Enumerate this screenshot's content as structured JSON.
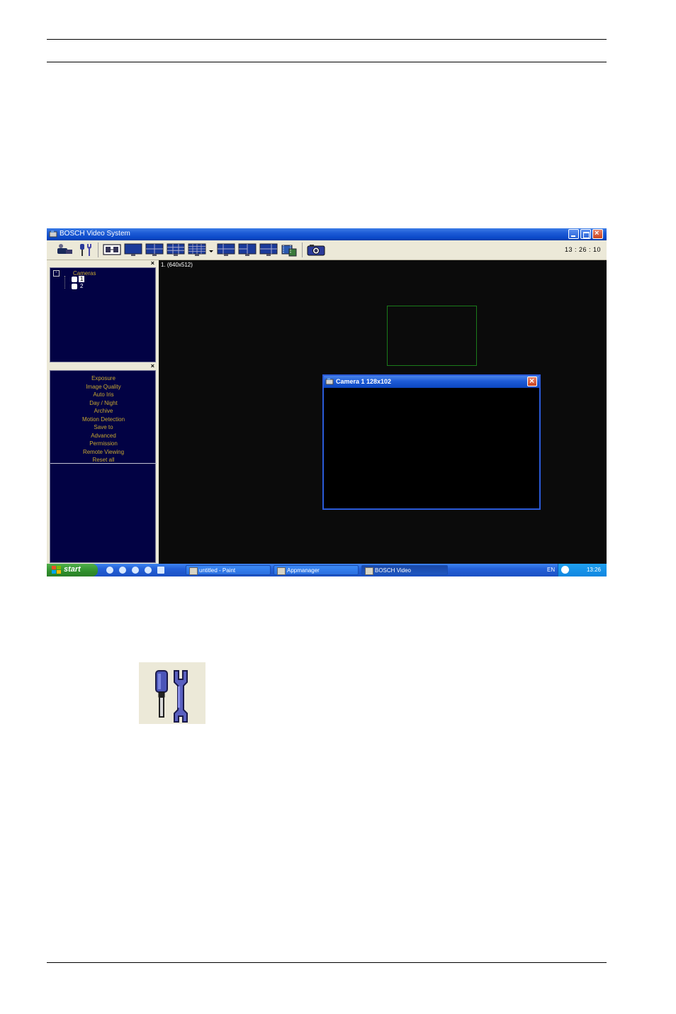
{
  "window": {
    "title": "BOSCH Video System",
    "clock": "13 : 26 : 10"
  },
  "toolbar": {
    "buttons": [
      "cameras-icon",
      "settings-icon",
      "single-view-icon",
      "monitor-icon",
      "quad-view-icon",
      "nine-view-icon",
      "sixteen-view-icon",
      "layout-dropdown-icon",
      "layout-a-icon",
      "layout-b-icon",
      "layout-c-icon",
      "playback-icon",
      "snapshot-icon"
    ]
  },
  "tree": {
    "root": "Cameras",
    "cameras": [
      "1",
      "2"
    ]
  },
  "settings_menu": {
    "items": [
      "Exposure",
      "Image Quality",
      "Auto Iris",
      "Day / Night",
      "Archive",
      "Motion Detection",
      "Save to",
      "Advanced",
      "Permission",
      "Remote Viewing",
      "Reset all"
    ]
  },
  "video": {
    "label": "1.  (640x512)"
  },
  "camera_window": {
    "title": "Camera 1  128x102"
  },
  "taskbar": {
    "start": "start",
    "tasks": [
      "untitled - Paint",
      "Appmanager",
      "BOSCH Video"
    ],
    "lang": "EN",
    "time": "13:26"
  },
  "colors": {
    "panel_bg": "#020244",
    "menu_text": "#c8a830",
    "xp_blue": "#1d5bd6",
    "toolbar_bg": "#ece9d8"
  }
}
